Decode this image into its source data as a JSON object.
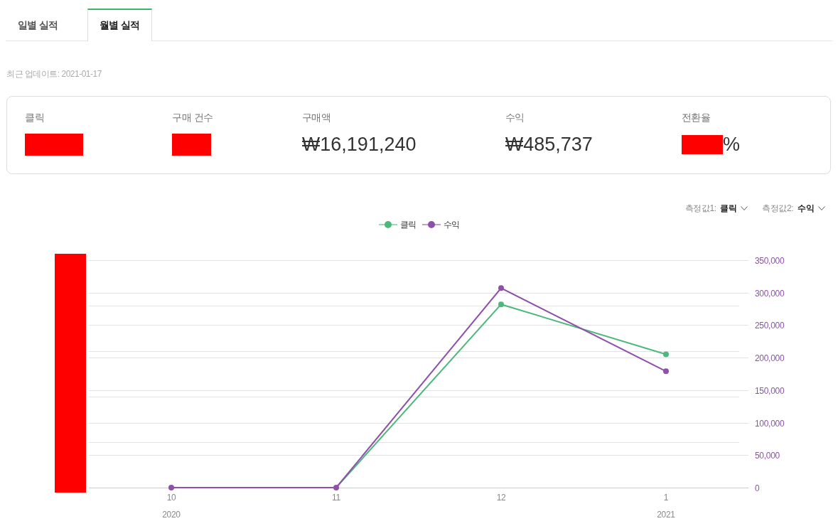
{
  "tabs": [
    {
      "label": "일별 실적",
      "selected": false
    },
    {
      "label": "월별 실적",
      "selected": true
    }
  ],
  "last_updated": "최근 업데이트: 2021-01-17",
  "summary": {
    "metrics": [
      {
        "label": "클릭",
        "redacted": true
      },
      {
        "label": "구매 건수",
        "redacted": true
      },
      {
        "label": "구매액",
        "redacted": false,
        "value": "₩16,191,240"
      },
      {
        "label": "수익",
        "redacted": false,
        "value": "₩485,737"
      },
      {
        "label": "전환율",
        "redacted": true,
        "suffix": "%"
      }
    ]
  },
  "chart": {
    "measures": [
      {
        "label": "측정값1:",
        "value": "클릭"
      },
      {
        "label": "측정값2:",
        "value": "수익"
      }
    ],
    "left_axis": {
      "redacted": true
    },
    "chart_data": {
      "type": "line",
      "categories": [
        "10",
        "11",
        "12",
        "1"
      ],
      "series": [
        {
          "name": "클릭",
          "color": "#4cb87a",
          "marker": "circle",
          "values": [
            0,
            0,
            282000,
            205000
          ]
        },
        {
          "name": "수익",
          "color": "#8e50a9",
          "marker": "circle",
          "values": [
            0,
            0,
            307000,
            179000
          ]
        }
      ],
      "ylim": [
        0,
        350000
      ],
      "yticks": [
        {
          "value": 0,
          "label": "0"
        },
        {
          "value": 50000,
          "label": "50,000"
        },
        {
          "value": 100000,
          "label": "100,000"
        },
        {
          "value": 150000,
          "label": "150,000"
        },
        {
          "value": 200000,
          "label": "200,000"
        },
        {
          "value": 250000,
          "label": "250,000"
        },
        {
          "value": 300000,
          "label": "300,000"
        },
        {
          "value": 350000,
          "label": "350,000"
        }
      ],
      "grid": true,
      "annotations": [
        "2020",
        "2021"
      ]
    }
  }
}
